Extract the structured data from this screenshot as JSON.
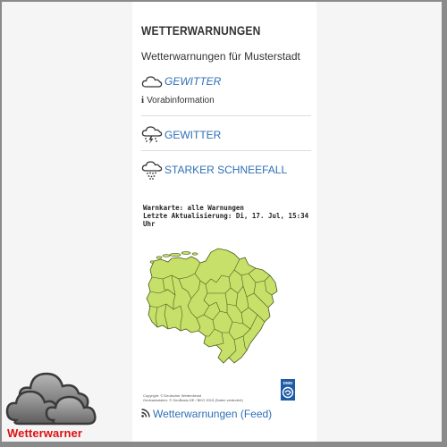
{
  "header": {
    "title": "WETTERWARNUNGEN",
    "subtitle": "Wetterwarnungen für Musterstadt"
  },
  "warnings": [
    {
      "label": "GEWITTER",
      "icon": "cloud-icon",
      "style": "italic"
    },
    {
      "label": "GEWITTER",
      "icon": "thunder-rain-cloud-icon",
      "style": "normal"
    },
    {
      "label": "STARKER SCHNEEFALL",
      "icon": "snow-cloud-icon",
      "style": "normal"
    }
  ],
  "pre_info": {
    "icon": "info-icon",
    "label": "Vorabinformation"
  },
  "map_meta": {
    "line1": "Warnkarte: alle Warnungen",
    "line2": "Letzte Aktualisierung: Di, 17. Jul, 15:34 Uhr"
  },
  "map": {
    "region_color": "#c6e06a",
    "border_color": "#4a5a1a"
  },
  "copyright": {
    "line1": "Copyright: © Deutscher Wetterdienst",
    "line2": "Geobasisdaten: © GeoBasis-DE / BKG 2015 (Daten verändert)"
  },
  "dwd_logo": {
    "label": "DWD"
  },
  "feed": {
    "label": "Wetterwarnungen (Feed)",
    "icon": "rss-icon"
  },
  "brand": {
    "label": "Wetterwarner",
    "color": "#dd1111",
    "icon": "cloud-stack-icon"
  },
  "colors": {
    "link": "#2f6fb5",
    "text": "#333333",
    "frame": "#8a8a8a"
  }
}
